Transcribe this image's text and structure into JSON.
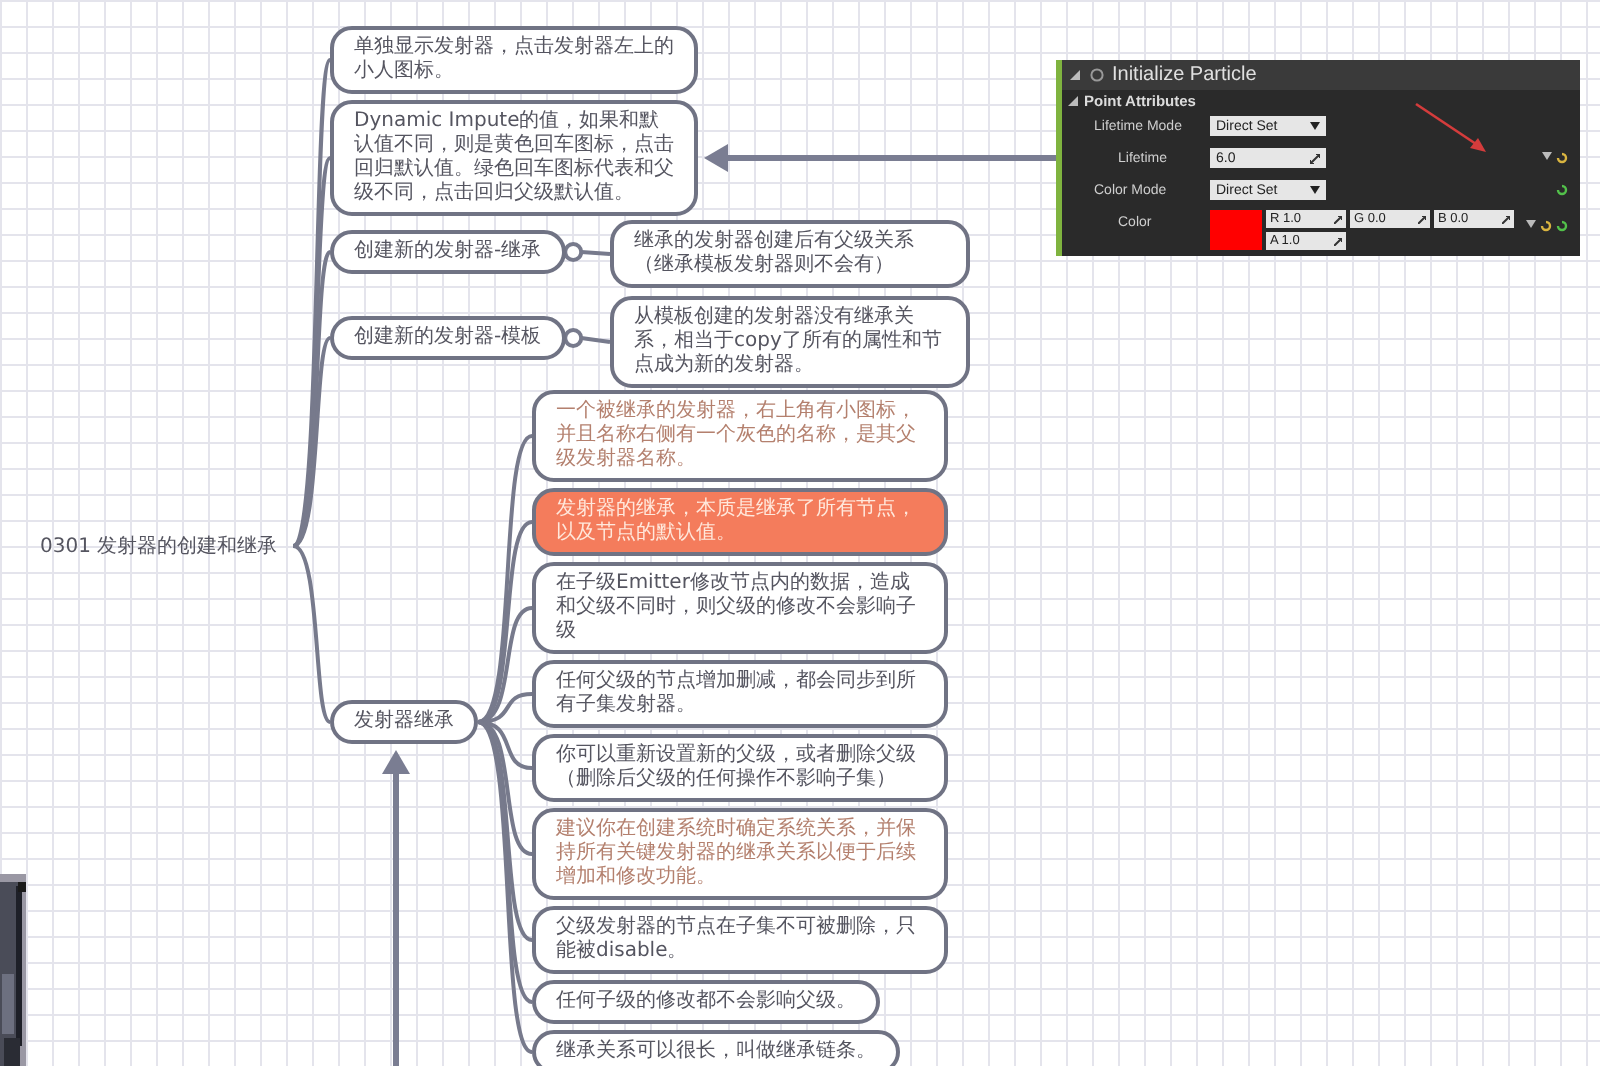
{
  "mind_map": {
    "root": {
      "label": "0301 发射器的创建和继承"
    },
    "topics": [
      {
        "label": "单独显示发射器，点击发射器左上的小人图标。",
        "kind": "plain"
      },
      {
        "label": "Dynamic Impute的值，如果和默认值不同，则是黄色回车图标，点击回归默认值。绿色回车图标代表和父级不同，点击回归父级默认值。",
        "kind": "plain"
      },
      {
        "label": "创建新的发射器-继承",
        "kind": "plain",
        "children": [
          {
            "label": "继承的发射器创建后有父级关系（继承模板发射器则不会有）",
            "kind": "plain"
          }
        ]
      },
      {
        "label": "创建新的发射器-模板",
        "kind": "plain",
        "children": [
          {
            "label": "从模板创建的发射器没有继承关系，相当于copy了所有的属性和节点成为新的发射器。",
            "kind": "plain"
          }
        ]
      },
      {
        "label": "发射器继承",
        "kind": "plain",
        "children": [
          {
            "label": "一个被继承的发射器，右上角有小图标，并且名称右侧有一个灰色的名称，是其父级发射器名称。",
            "kind": "note"
          },
          {
            "label": "发射器的继承，本质是继承了所有节点，以及节点的默认值。",
            "kind": "highlight"
          },
          {
            "label": "在子级Emitter修改节点内的数据，造成和父级不同时，则父级的修改不会影响子级",
            "kind": "plain"
          },
          {
            "label": "任何父级的节点增加删减，都会同步到所有子集发射器。",
            "kind": "plain"
          },
          {
            "label": "你可以重新设置新的父级，或者删除父级（删除后父级的任何操作不影响子集）",
            "kind": "plain"
          },
          {
            "label": "建议你在创建系统时确定系统关系，并保持所有关键发射器的继承关系以便于后续增加和修改功能。",
            "kind": "note"
          },
          {
            "label": "父级发射器的节点在子集不可被删除，只能被disable。",
            "kind": "plain"
          },
          {
            "label": "任何子级的修改都不会影响父级。",
            "kind": "plain"
          },
          {
            "label": "继承关系可以很长，叫做继承链条。",
            "kind": "plain"
          }
        ]
      }
    ]
  },
  "screenshot": {
    "title": "Initialize Particle",
    "section": "Point Attributes",
    "rows": [
      {
        "kind": "dropdown",
        "label": "Lifetime Mode",
        "value": "Direct Set"
      },
      {
        "kind": "number",
        "label": "Lifetime",
        "value": "6.0"
      },
      {
        "kind": "dropdown",
        "label": "Color Mode",
        "value": "Direct Set"
      },
      {
        "kind": "color",
        "label": "Color",
        "color": "#ff0000",
        "fields": [
          "R 1.0",
          "G 0.0",
          "B 0.0",
          "A 1.0"
        ]
      }
    ]
  }
}
